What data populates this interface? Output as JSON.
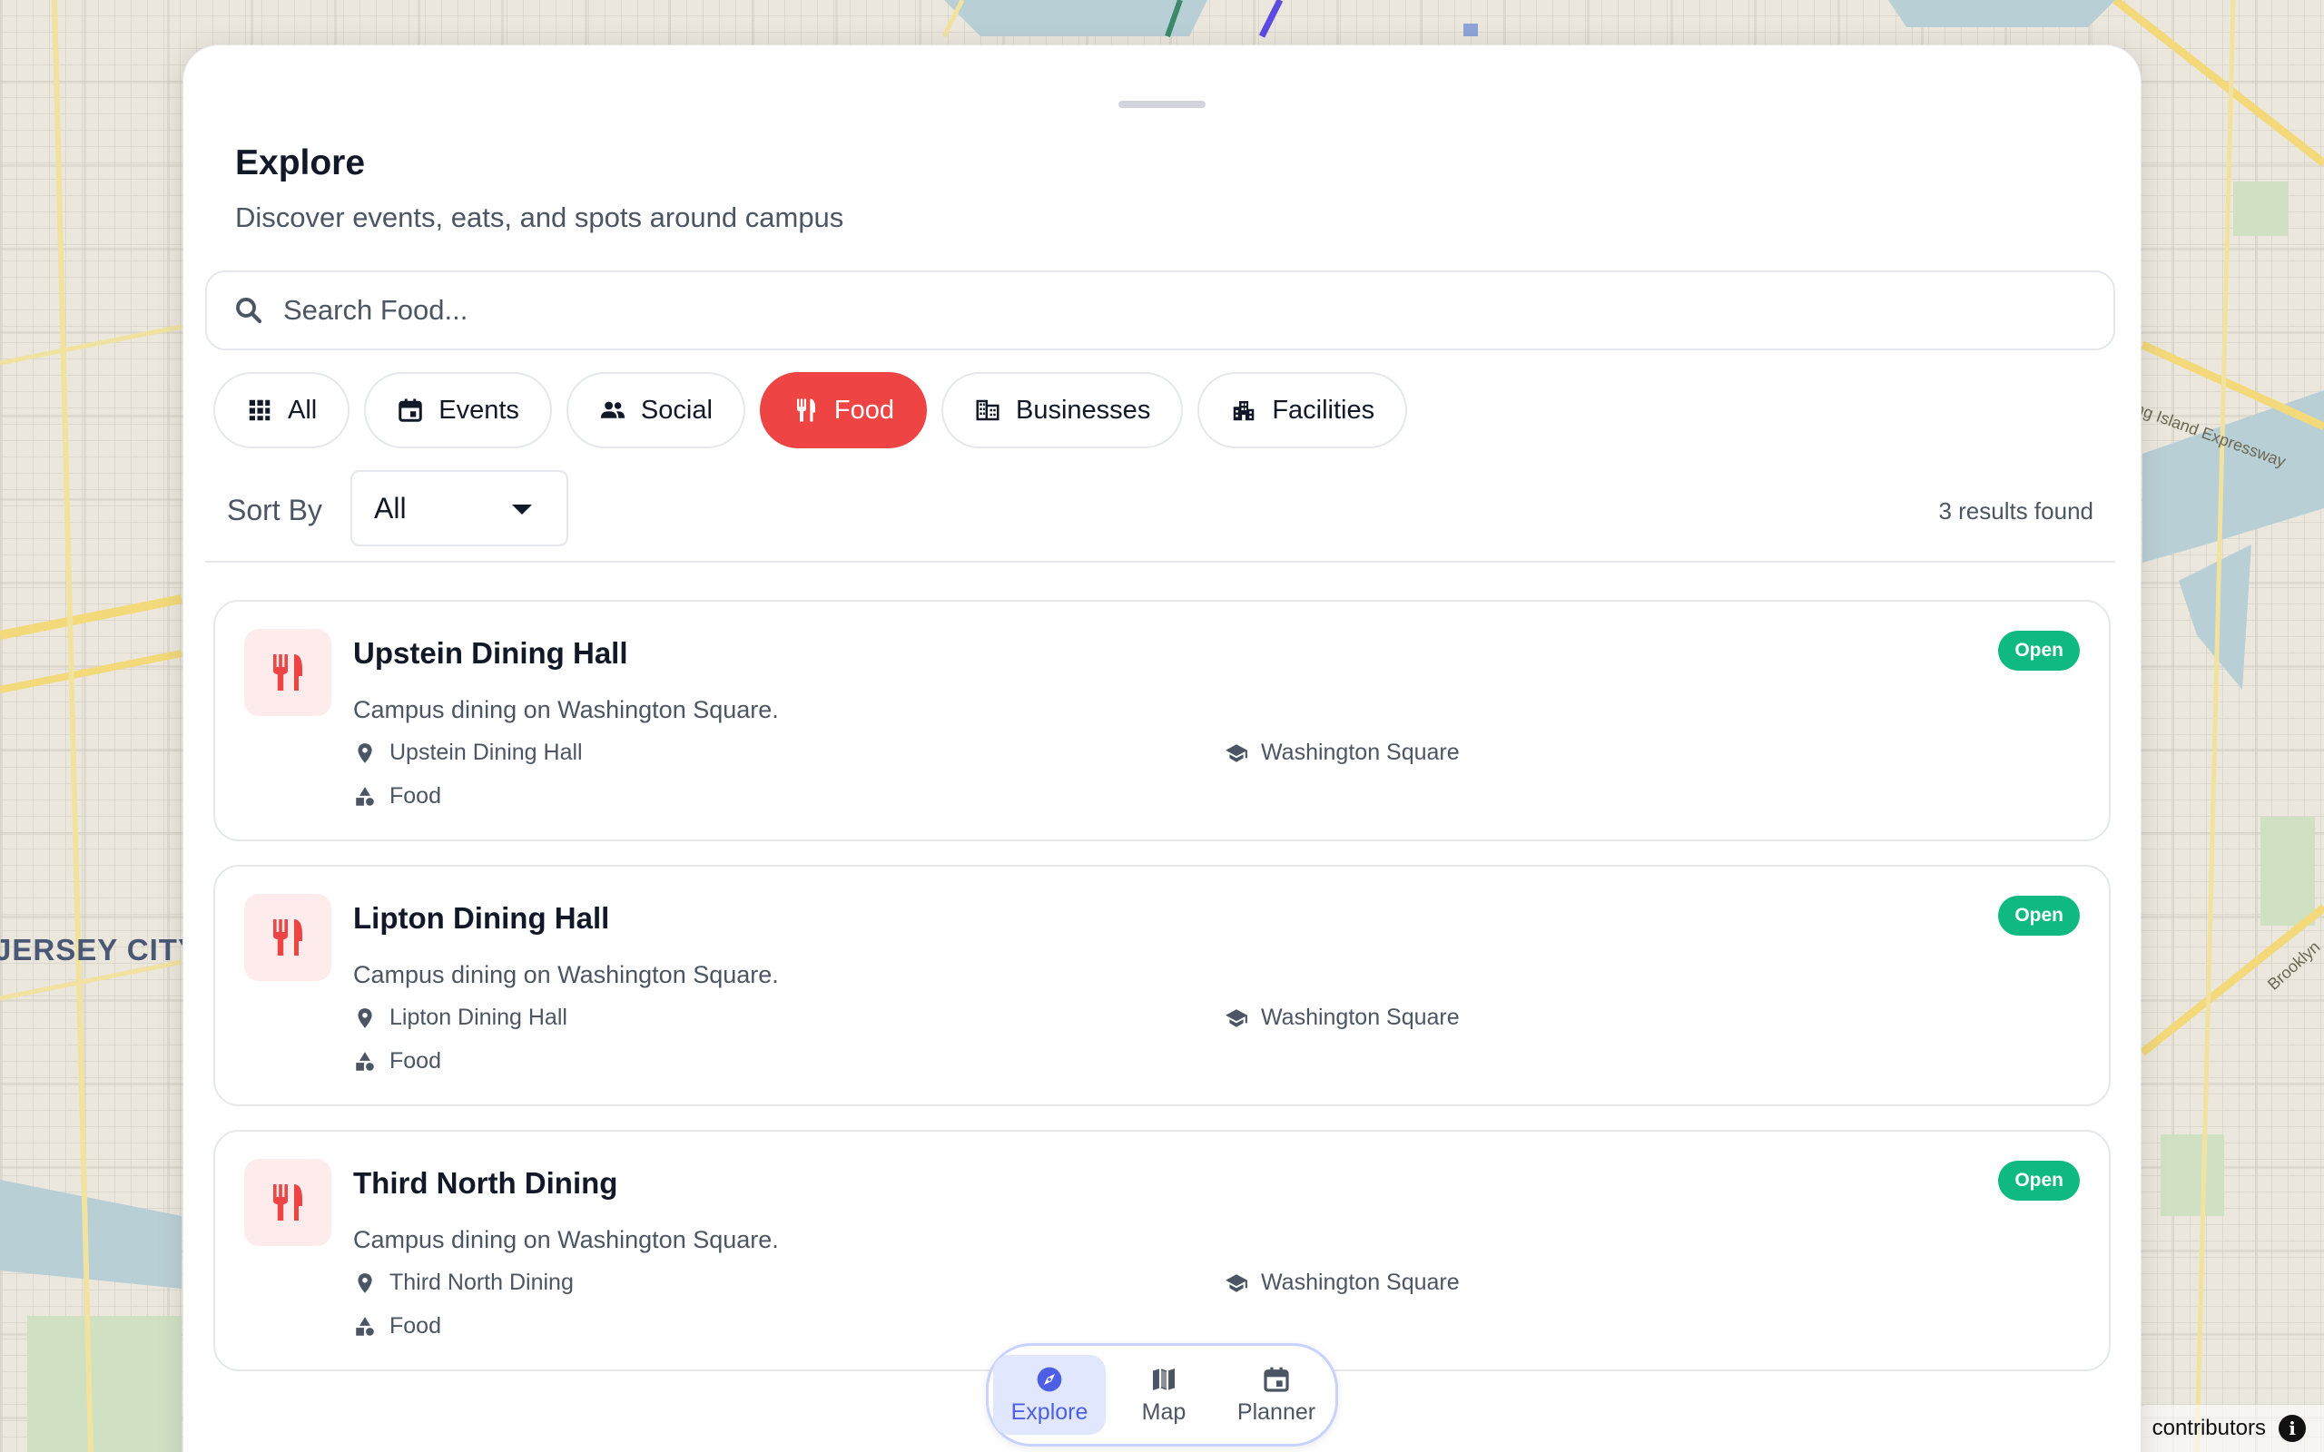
{
  "map": {
    "city_label": "JERSEY CITY",
    "road_label": "ng Island Expressway",
    "road_label_2": "Brooklyn",
    "attribution": "contributors"
  },
  "panel": {
    "title": "Explore",
    "subtitle": "Discover events, eats, and spots around campus"
  },
  "search": {
    "placeholder": "Search Food..."
  },
  "filters": [
    {
      "label": "All",
      "icon": "grid-icon",
      "active": false
    },
    {
      "label": "Events",
      "icon": "calendar-icon",
      "active": false
    },
    {
      "label": "Social",
      "icon": "people-icon",
      "active": false
    },
    {
      "label": "Food",
      "icon": "utensils-icon",
      "active": true
    },
    {
      "label": "Businesses",
      "icon": "building-icon",
      "active": false
    },
    {
      "label": "Facilities",
      "icon": "facility-icon",
      "active": false
    }
  ],
  "sort": {
    "label": "Sort By",
    "selected": "All",
    "results_text": "3 results found"
  },
  "results": [
    {
      "name": "Upstein Dining Hall",
      "description": "Campus dining on Washington Square.",
      "location": "Upstein Dining Hall",
      "campus": "Washington Square",
      "category": "Food",
      "status": "Open"
    },
    {
      "name": "Lipton Dining Hall",
      "description": "Campus dining on Washington Square.",
      "location": "Lipton Dining Hall",
      "campus": "Washington Square",
      "category": "Food",
      "status": "Open"
    },
    {
      "name": "Third North Dining",
      "description": "Campus dining on Washington Square.",
      "location": "Third North Dining",
      "campus": "Washington Square",
      "category": "Food",
      "status": "Open"
    }
  ],
  "nav": [
    {
      "label": "Explore",
      "icon": "compass-icon",
      "active": true
    },
    {
      "label": "Map",
      "icon": "map-icon",
      "active": false
    },
    {
      "label": "Planner",
      "icon": "calendar-icon",
      "active": false
    }
  ],
  "colors": {
    "accent_red": "#ef4444",
    "open_green": "#10b981",
    "nav_active": "#4f5fe5"
  }
}
